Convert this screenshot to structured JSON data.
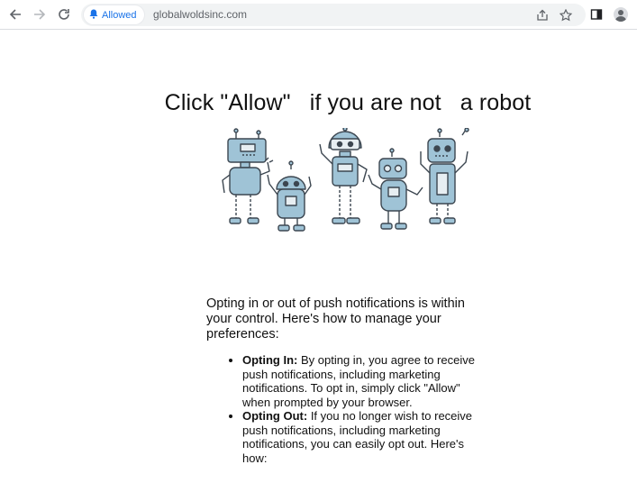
{
  "browser": {
    "permission_chip": {
      "label": "Allowed",
      "icon": "bell-icon"
    },
    "url": "globalwoldsinc.com",
    "nav": {
      "back": "back-arrow-icon",
      "forward": "forward-arrow-icon",
      "reload": "reload-icon"
    },
    "actions": {
      "share": "share-icon",
      "bookmark": "star-icon",
      "side_panel": "side-panel-icon",
      "profile": "profile-avatar"
    }
  },
  "page": {
    "headline": "Click \"Allow\"   if you are not   a robot",
    "image": "cartoon-robots-illustration",
    "intro": "Opting in or out of push notifications is within your control. Here's how to manage your preferences:",
    "items": [
      {
        "title": "Opting In:",
        "text": " By opting in, you agree to receive push notifications, including marketing notifications. To opt in, simply click \"Allow\" when prompted by your browser."
      },
      {
        "title": "Opting Out:",
        "text": " If you no longer wish to receive push notifications, including marketing notifications, you can easily opt out. Here's how:"
      }
    ]
  },
  "colors": {
    "accent": "#1a73e8",
    "robot_fill": "#9fc3d6",
    "robot_stroke": "#3c4650",
    "omnibox_bg": "#f1f3f4"
  }
}
